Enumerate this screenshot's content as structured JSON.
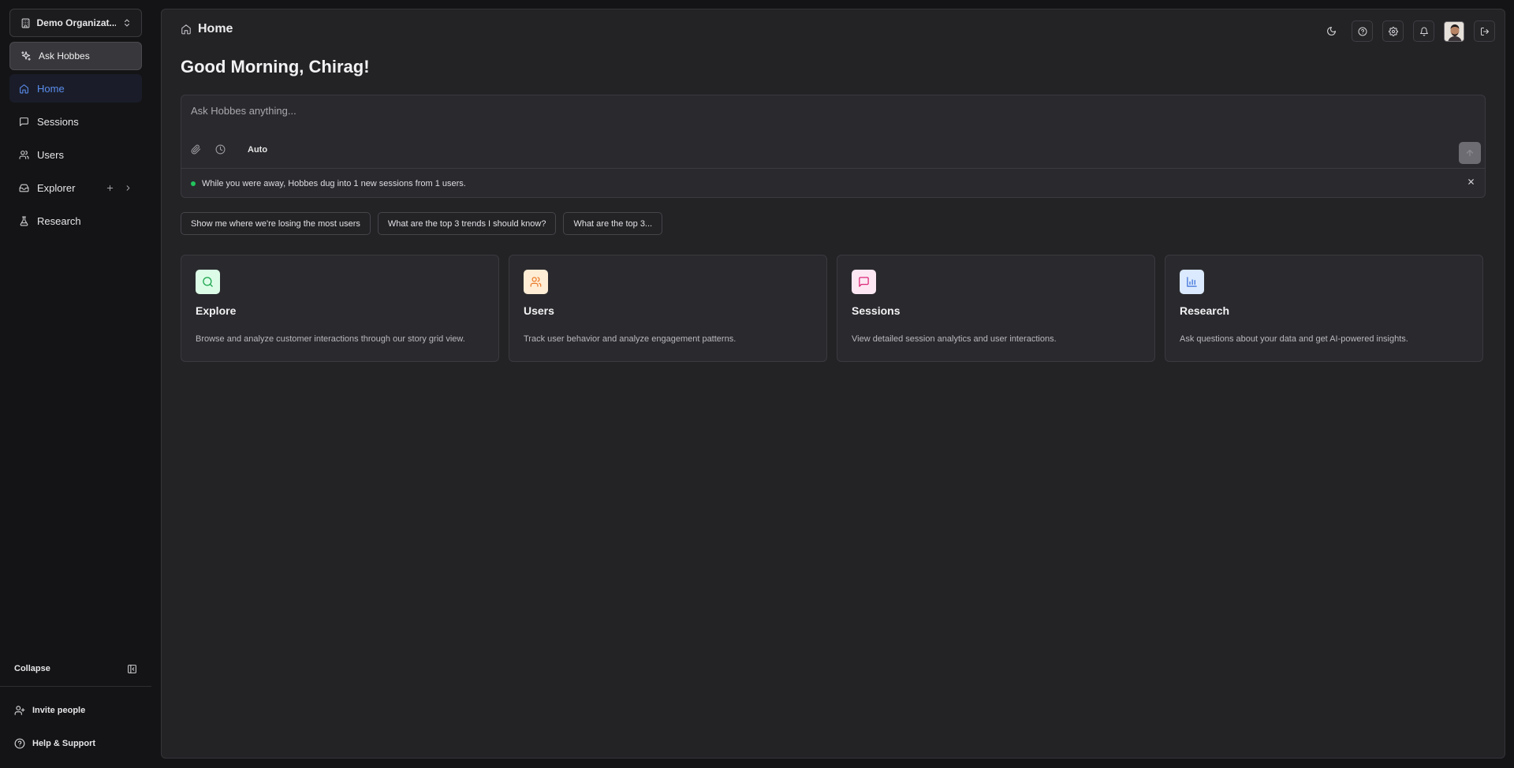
{
  "sidebar": {
    "org_name": "Demo Organizat...",
    "ask_label": "Ask Hobbes",
    "nav": [
      {
        "label": "Home",
        "icon": "home-icon",
        "active": true
      },
      {
        "label": "Sessions",
        "icon": "message-square-icon"
      },
      {
        "label": "Users",
        "icon": "users-icon"
      },
      {
        "label": "Explorer",
        "icon": "inbox-icon"
      },
      {
        "label": "Research",
        "icon": "flask-icon"
      }
    ],
    "collapse_label": "Collapse",
    "invite_label": "Invite people",
    "help_label": "Help & Support"
  },
  "header": {
    "breadcrumb": "Home",
    "greeting": "Good Morning, Chirag!"
  },
  "ask": {
    "placeholder": "Ask Hobbes anything...",
    "value": "",
    "mode": "Auto",
    "notice": "While you were away, Hobbes dug into 1 new sessions from 1 users."
  },
  "suggestions": [
    "Show me where we're losing the most users",
    "What are the top 3 trends I should know?",
    "What are the top 3..."
  ],
  "cards": [
    {
      "title": "Explore",
      "desc": "Browse and analyze customer interactions through our story grid view.",
      "icon": "search-icon",
      "color": "#16a34a",
      "bg": "#dcfce7"
    },
    {
      "title": "Users",
      "desc": "Track user behavior and analyze engagement patterns.",
      "icon": "users-icon",
      "color": "#ea7a2a",
      "bg": "#ffedd5"
    },
    {
      "title": "Sessions",
      "desc": "View detailed session analytics and user interactions.",
      "icon": "message-square-icon",
      "color": "#db2777",
      "bg": "#fce7f3"
    },
    {
      "title": "Research",
      "desc": "Ask questions about your data and get AI-powered insights.",
      "icon": "bar-chart-icon",
      "color": "#3b6fd8",
      "bg": "#dbeafe"
    }
  ],
  "colors": {
    "accent": "#5b8def",
    "status_dot": "#22c55e"
  }
}
